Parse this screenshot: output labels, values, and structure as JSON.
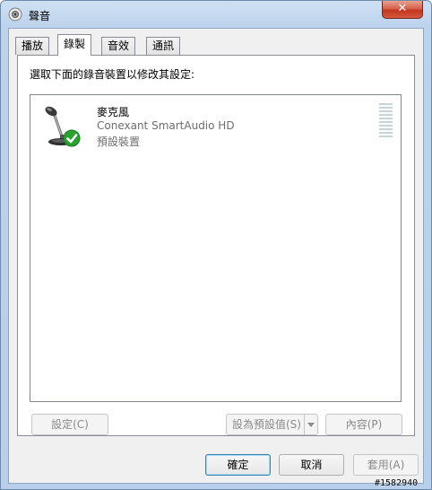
{
  "window": {
    "title": "聲音",
    "close_glyph": "✕"
  },
  "tabs": [
    {
      "label": "播放",
      "active": false
    },
    {
      "label": "錄製",
      "active": true
    },
    {
      "label": "音效",
      "active": false
    },
    {
      "label": "通訊",
      "active": false
    }
  ],
  "instruction": "選取下面的錄音裝置以修改其設定:",
  "device": {
    "name": "麥克風",
    "driver": "Conexant SmartAudio HD",
    "status": "預設裝置",
    "icon": "microphone-icon",
    "status_icon": "default-check-icon"
  },
  "panel_buttons": {
    "configure": "設定(C)",
    "set_default": "設為預設值(S)",
    "properties": "內容(P)"
  },
  "dialog_buttons": {
    "ok": "確定",
    "cancel": "取消",
    "apply": "套用(A)"
  },
  "watermark": "#1582940",
  "colors": {
    "accent": "#3c7fb1",
    "check": "#2aa131",
    "level": "#c5d5d9"
  }
}
